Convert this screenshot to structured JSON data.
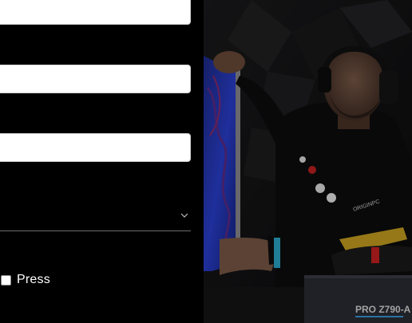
{
  "form": {
    "field1": {
      "value": "",
      "placeholder": ""
    },
    "field2": {
      "value": "",
      "placeholder": ""
    },
    "field3": {
      "value": "",
      "placeholder": ""
    },
    "select": {
      "value": ""
    },
    "checkbox": {
      "label": "Press",
      "checked": false
    }
  },
  "photo": {
    "shirt_text": "ORIGINPC",
    "box_text": "PRO Z790-A",
    "alt": "man holding glass panel"
  }
}
